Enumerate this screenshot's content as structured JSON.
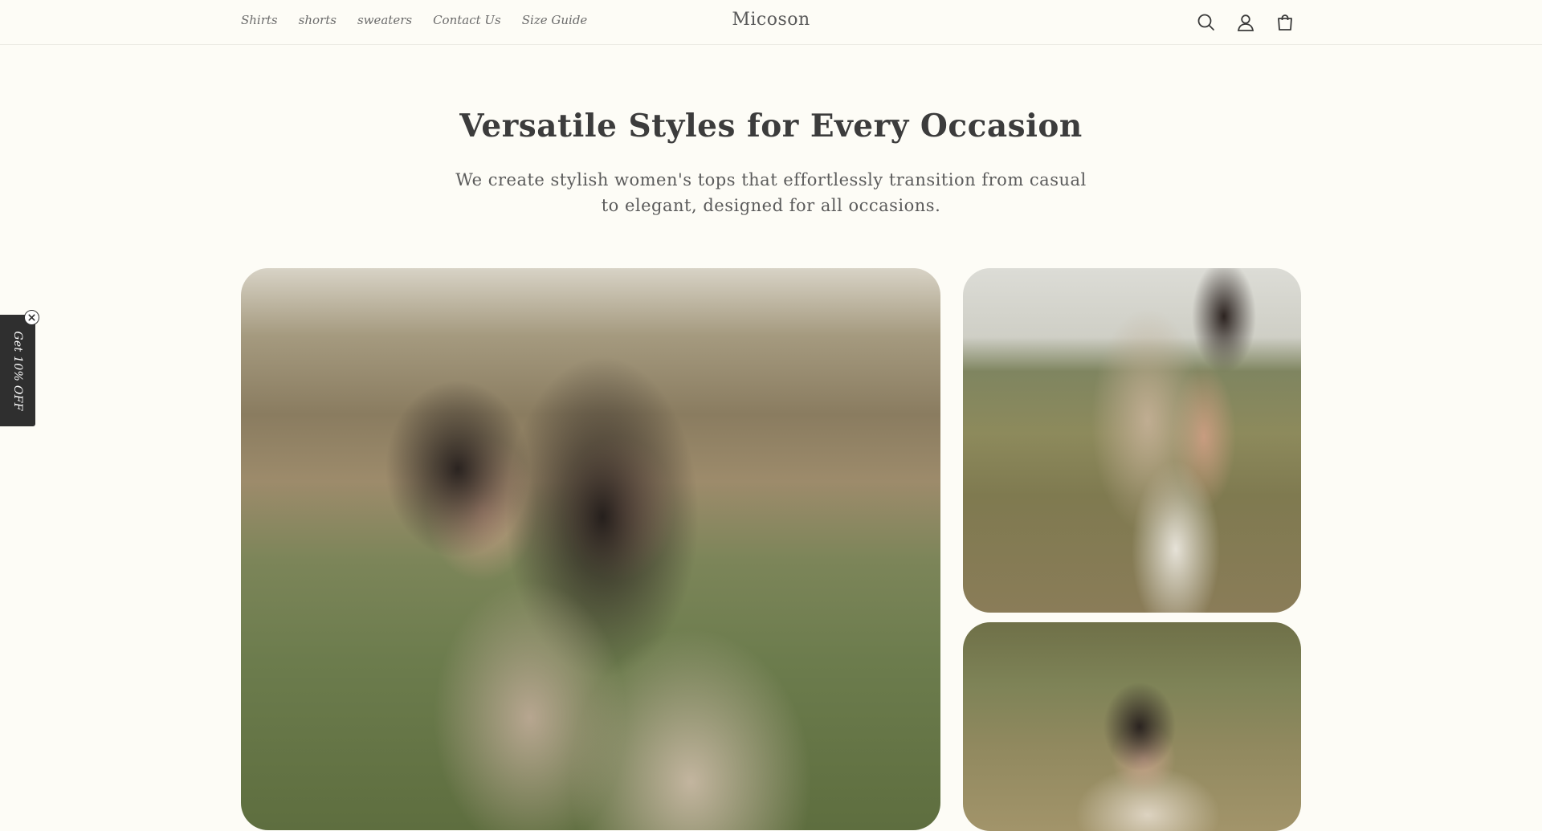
{
  "nav": {
    "items": [
      {
        "label": "Shirts"
      },
      {
        "label": "shorts"
      },
      {
        "label": "sweaters"
      },
      {
        "label": "Contact Us"
      },
      {
        "label": "Size Guide"
      }
    ]
  },
  "brand": {
    "name": "Micoson"
  },
  "header_icons": [
    "search-icon",
    "account-icon",
    "cart-icon"
  ],
  "hero": {
    "title": "Versatile Styles for Every Occasion",
    "subtitle": "We create stylish women's tops that effortlessly transition from casual to elegant, designed for all occasions."
  },
  "promo": {
    "label": "Get 10% OFF"
  },
  "colors": {
    "background": "#fdfcf6",
    "text": "#3c3c3c",
    "promo_tab": "#2f2f2f"
  }
}
